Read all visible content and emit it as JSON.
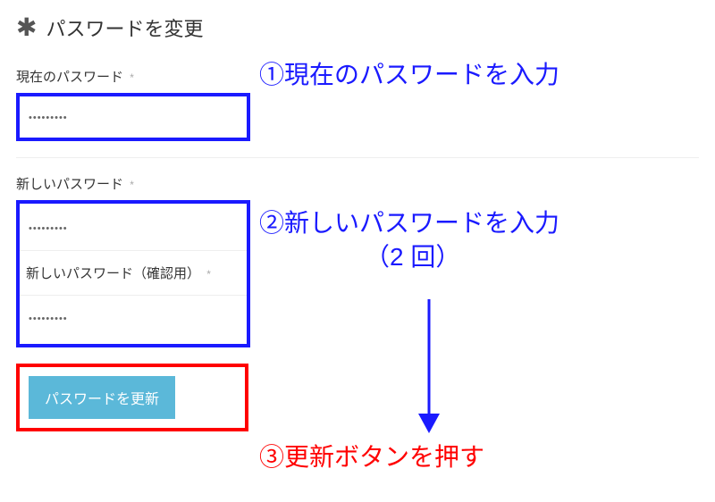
{
  "header": {
    "icon_name": "asterisk-icon",
    "title": "パスワードを変更"
  },
  "form": {
    "current_password": {
      "label": "現在のパスワード",
      "required_mark": "*",
      "value": "•••••••••"
    },
    "new_password": {
      "label": "新しいパスワード",
      "required_mark": "*",
      "value": "•••••••••"
    },
    "new_password_confirm": {
      "label": "新しいパスワード（確認用）",
      "required_mark": "*",
      "value": "•••••••••"
    },
    "submit_label": "パスワードを更新"
  },
  "annotations": {
    "step1": "①現在のパスワードを入力",
    "step2_line1": "②新しいパスワードを入力",
    "step2_line2": "（2 回）",
    "step3": "③更新ボタンを押す"
  },
  "colors": {
    "accent_blue": "#1a1aff",
    "accent_red": "#ff0000",
    "button_bg": "#5bb8d9"
  }
}
